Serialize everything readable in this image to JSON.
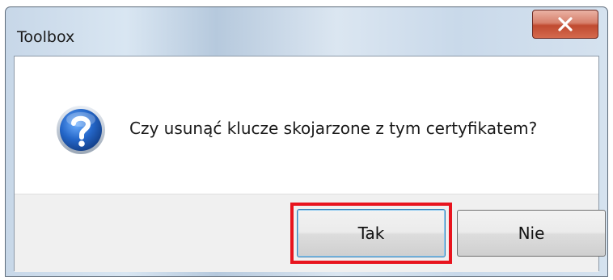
{
  "window": {
    "title": "Toolbox",
    "close_icon": "close-icon"
  },
  "dialog": {
    "icon": "question-icon",
    "message": "Czy usunąć klucze skojarzone z tym certyfikatem?"
  },
  "buttons": {
    "yes_label": "Tak",
    "no_label": "Nie"
  },
  "colors": {
    "highlight": "#e8141e",
    "close_button": "#c04a30",
    "icon_blue": "#1f5fb7"
  }
}
